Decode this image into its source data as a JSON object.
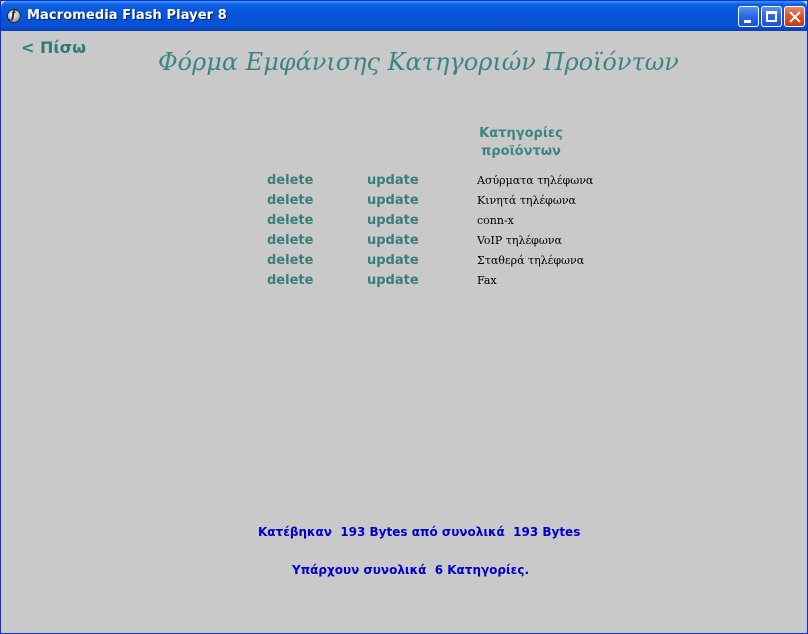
{
  "window": {
    "title": "Macromedia Flash Player 8"
  },
  "nav": {
    "back_label": "< Πίσω"
  },
  "page": {
    "title": "Φόρμα Εμφάνισης Κατηγοριών Προϊόντων",
    "column_header_line1": "Κατηγορίες",
    "column_header_line2": "προϊόντων"
  },
  "rows": [
    {
      "delete_label": "delete",
      "update_label": "update",
      "category": "Ασύρματα τηλέφωνα"
    },
    {
      "delete_label": "delete",
      "update_label": "update",
      "category": "Κινητά τηλέφωνα"
    },
    {
      "delete_label": "delete",
      "update_label": "update",
      "category": "conn-x"
    },
    {
      "delete_label": "delete",
      "update_label": "update",
      "category": "VoIP τηλέφωνα"
    },
    {
      "delete_label": "delete",
      "update_label": "update",
      "category": "Σταθερά τηλέφωνα"
    },
    {
      "delete_label": "delete",
      "update_label": "update",
      "category": "Fax"
    }
  ],
  "status": {
    "download_text": "Κατέβηκαν  193 Bytes από συνολικά  193 Bytes",
    "total_text": "Υπάρχουν συνολικά  6 Κατηγορίες."
  },
  "colors": {
    "background": "#c9c9c9",
    "accent_teal": "#3a8684",
    "status_blue": "#0000cc",
    "titlebar_blue": "#0854d8"
  },
  "icons": {
    "app": "flash-player-icon",
    "minimize": "minimize-icon",
    "maximize": "maximize-icon",
    "close": "close-icon"
  }
}
